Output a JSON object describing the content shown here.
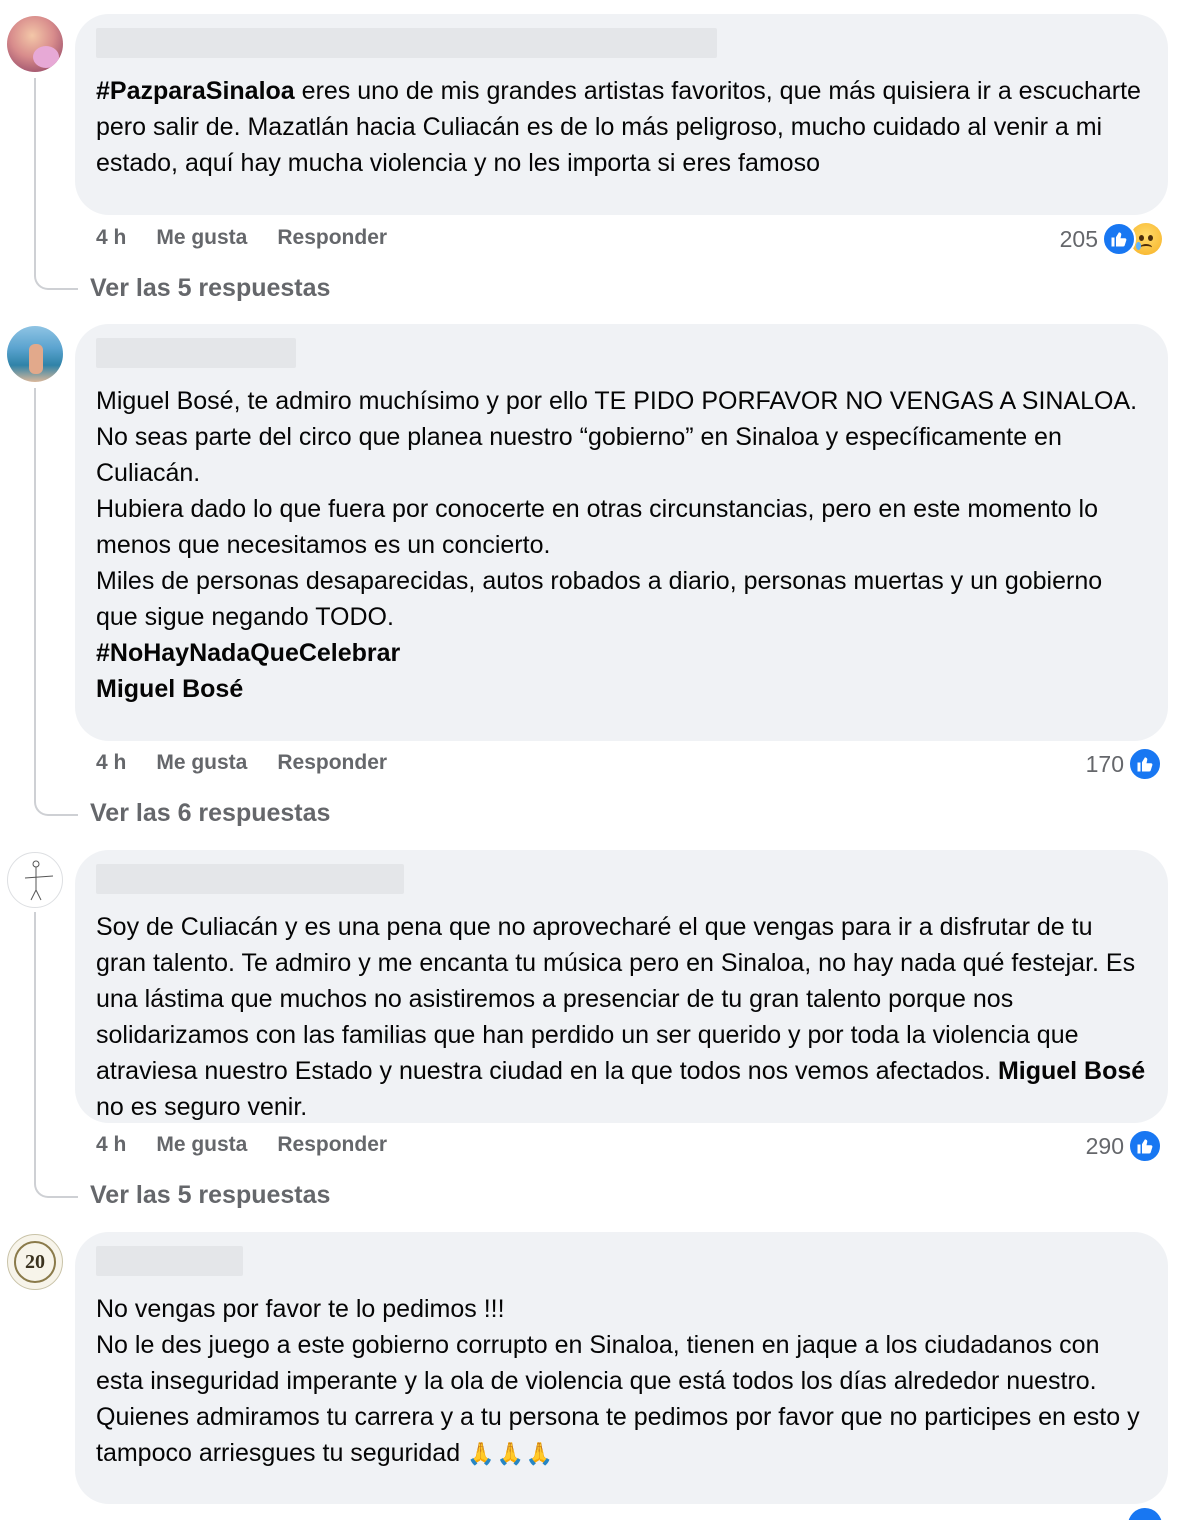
{
  "comments": [
    {
      "body_parts": [
        {
          "text": "#PazparaSinaloa",
          "bold": true
        },
        {
          "text": " eres uno de mis grandes artistas favoritos, que más quisiera ir a escucharte pero salir de. Mazatlán hacia Culiacán es de lo más peligroso, mucho cuidado al venir a mi estado, aquí hay mucha violencia y no les importa si eres famoso",
          "bold": false
        }
      ],
      "time": "4 h",
      "like_label": "Me gusta",
      "reply_label": "Responder",
      "reaction_count": "205",
      "reactions": [
        "like-icon",
        "sad-icon"
      ],
      "view_replies": "Ver las 5 respuestas"
    },
    {
      "body_parts": [
        {
          "text": "Miguel Bosé, te admiro muchísimo y por ello TE PIDO PORFAVOR NO VENGAS A SINALOA.\nNo seas parte del circo que planea nuestro “gobierno” en Sinaloa y específicamente en Culiacán.\nHubiera dado lo que fuera por conocerte en otras circunstancias, pero en este momento lo menos que necesitamos es un concierto.\nMiles de personas desaparecidas, autos robados a diario, personas muertas y un gobierno que sigue negando TODO.\n",
          "bold": false
        },
        {
          "text": "#NoHayNadaQueCelebrar\nMiguel Bosé",
          "bold": true
        }
      ],
      "time": "4 h",
      "like_label": "Me gusta",
      "reply_label": "Responder",
      "reaction_count": "170",
      "reactions": [
        "like-icon"
      ],
      "view_replies": "Ver las 6 respuestas"
    },
    {
      "body_parts": [
        {
          "text": "Soy de Culiacán y es una pena que no aprovecharé el que vengas para ir a disfrutar de tu gran talento. Te admiro y me encanta tu música pero en Sinaloa, no hay nada qué festejar. Es una lástima que muchos no asistiremos a presenciar de tu gran talento porque nos solidarizamos con las familias que han perdido un ser querido y por toda la violencia que atraviesa nuestro Estado y nuestra ciudad en la que todos nos vemos afectados. ",
          "bold": false
        },
        {
          "text": "Miguel Bosé",
          "bold": true
        },
        {
          "text": " no es seguro venir.",
          "bold": false
        }
      ],
      "time": "4 h",
      "like_label": "Me gusta",
      "reply_label": "Responder",
      "reaction_count": "290",
      "reactions": [
        "like-icon"
      ],
      "view_replies": "Ver las 5 respuestas"
    },
    {
      "body_parts": [
        {
          "text": "No vengas por favor te lo pedimos !!!\nNo le des juego a este gobierno corrupto en Sinaloa, tienen en jaque a los ciudadanos con esta inseguridad imperante y la ola de violencia que está todos los días alrededor nuestro.\nQuienes admiramos tu carrera y a tu persona te pedimos por favor que no participes en esto y tampoco arriesgues tu seguridad ",
          "bold": false
        },
        {
          "text": "🙏🙏🙏",
          "bold": false,
          "emoji": true
        }
      ],
      "avatar_badge": "20"
    }
  ],
  "colors": {
    "bubble": "#f0f2f5",
    "meta_text": "#65676b",
    "like_blue": "#1877f2",
    "thread_line": "#ced0d4"
  }
}
